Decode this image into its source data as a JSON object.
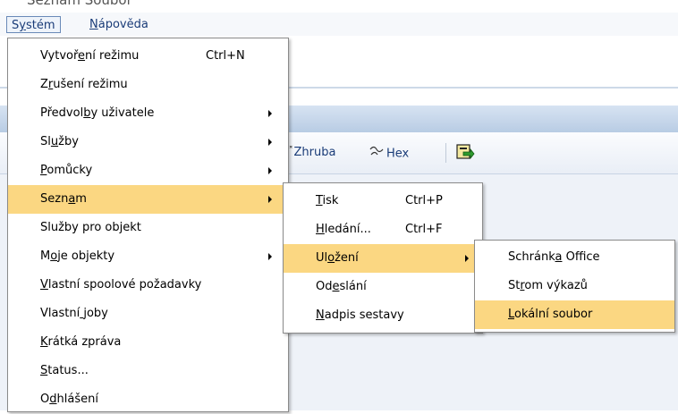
{
  "top_strip_text": "Seznam  Soubor",
  "menubar": [
    {
      "pre": "S",
      "u": "y",
      "post": "stém",
      "active": true
    },
    {
      "pre": "",
      "u": "N",
      "post": "ápověda",
      "active": false
    }
  ],
  "toolbar": {
    "zhruba_label": "Zhruba",
    "hex_label": "Hex",
    "export_icon": "export-icon"
  },
  "system_menu": [
    {
      "pre": "Vytvoř",
      "u": "e",
      "post": "ní režimu",
      "shortcut": "Ctrl+N",
      "submenu": false,
      "highlight": false
    },
    {
      "pre": "Z",
      "u": "r",
      "post": "ušení režimu",
      "shortcut": "",
      "submenu": false,
      "highlight": false
    },
    {
      "pre": "Předvol",
      "u": "b",
      "post": "y uživatele",
      "shortcut": "",
      "submenu": true,
      "highlight": false
    },
    {
      "pre": "Sl",
      "u": "u",
      "post": "žby",
      "shortcut": "",
      "submenu": true,
      "highlight": false
    },
    {
      "pre": "",
      "u": "P",
      "post": "omůcky",
      "shortcut": "",
      "submenu": true,
      "highlight": false
    },
    {
      "pre": "Sezn",
      "u": "a",
      "post": "m",
      "shortcut": "",
      "submenu": true,
      "highlight": true
    },
    {
      "pre": "Služby pro objekt",
      "u": "",
      "post": "",
      "shortcut": "",
      "submenu": false,
      "highlight": false
    },
    {
      "pre": "M",
      "u": "o",
      "post": "je objekty",
      "shortcut": "",
      "submenu": true,
      "highlight": false
    },
    {
      "pre": "",
      "u": "V",
      "post": "lastní spoolové požadavky",
      "shortcut": "",
      "submenu": false,
      "highlight": false
    },
    {
      "pre": "Vlastní",
      "u": " ",
      "post": "joby",
      "shortcut": "",
      "submenu": false,
      "highlight": false
    },
    {
      "pre": "",
      "u": "K",
      "post": "rátká zpráva",
      "shortcut": "",
      "submenu": false,
      "highlight": false
    },
    {
      "pre": "",
      "u": "S",
      "post": "tatus...",
      "shortcut": "",
      "submenu": false,
      "highlight": false
    },
    {
      "pre": "O",
      "u": "d",
      "post": "hlášení",
      "shortcut": "",
      "submenu": false,
      "highlight": false
    }
  ],
  "seznam_menu": [
    {
      "pre": "",
      "u": "T",
      "post": "isk",
      "shortcut": "Ctrl+P",
      "submenu": false,
      "highlight": false
    },
    {
      "pre": "",
      "u": "H",
      "post": "ledání...",
      "shortcut": "Ctrl+F",
      "submenu": false,
      "highlight": false
    },
    {
      "pre": "Ul",
      "u": "o",
      "post": "žení",
      "shortcut": "",
      "submenu": true,
      "highlight": true
    },
    {
      "pre": "Od",
      "u": "e",
      "post": "slání",
      "shortcut": "",
      "submenu": false,
      "highlight": false
    },
    {
      "pre": "",
      "u": "N",
      "post": "adpis sestavy",
      "shortcut": "",
      "submenu": false,
      "highlight": false
    }
  ],
  "ulozeni_menu": [
    {
      "pre": "Schránk",
      "u": "a",
      "post": " Office",
      "highlight": false
    },
    {
      "pre": "St",
      "u": "r",
      "post": "om výkazů",
      "highlight": false
    },
    {
      "pre": "",
      "u": "L",
      "post": "okální soubor",
      "highlight": true
    }
  ]
}
